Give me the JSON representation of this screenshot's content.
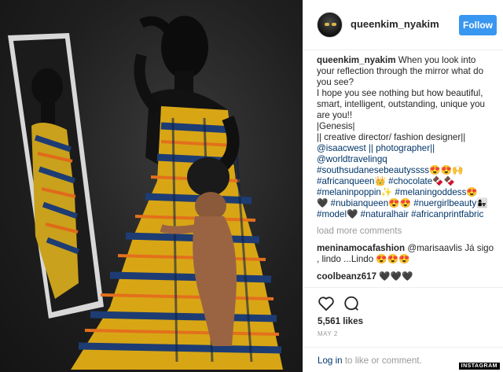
{
  "post": {
    "username": "queenkim_nyakim",
    "follow_label": "Follow",
    "caption_lines": [
      "When you look into your reflection through the mirror what do you see?",
      "I hope you see nothing but how beautiful, smart, intelligent, outstanding, unique you are you!!",
      "|Genesis|",
      "|| creative director/ fashion designer||",
      "@isaacwest || photographer||",
      "@worldtravelingq",
      "#southsudanesebeautyssss😍😍🙌",
      "#africanqueen👑 #chocolate🍫🍫",
      "#melaninpoppin✨ #melaningoddess😍",
      "🖤 #nubianqueen😍😍 #nuergirlbeauty👩‍👧",
      "#model🖤 #naturalhair #africanprintfabric"
    ],
    "load_more_label": "load more comments",
    "comments": [
      {
        "user": "meninamocafashion",
        "text": "@marisaavlis Já sigo , lindo ...Lindo 😍😍😍"
      },
      {
        "user": "coolbeanz617",
        "text": "🖤🖤🖤"
      }
    ],
    "likes": "5,561 likes",
    "date": "MAY 2",
    "login": {
      "link": "Log in",
      "rest": " to like or comment."
    },
    "more_icon": "···",
    "watermark": "INSTAGRAM"
  }
}
